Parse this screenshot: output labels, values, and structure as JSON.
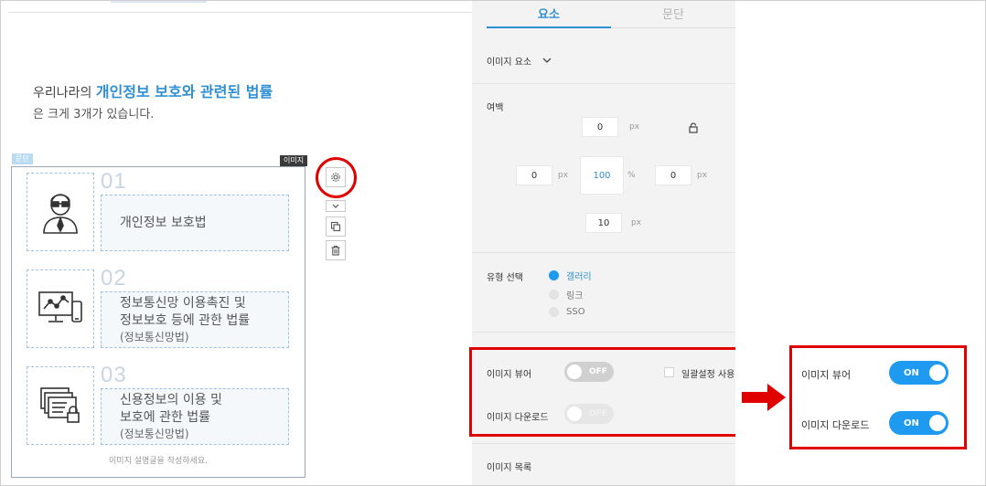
{
  "intro": {
    "prefix": "우리나라의",
    "highlight": "개인정보 보호와 관련된 법률",
    "line2": "은 크게 3개가 있습니다."
  },
  "tags": {
    "paragraph": "문단",
    "image": "이미지"
  },
  "laws": [
    {
      "number": "01",
      "title_line1": "개인정보 보호법",
      "title_line2": "",
      "sub": "",
      "icon": "person-with-glasses-icon"
    },
    {
      "number": "02",
      "title_line1": "정보통신망 이용촉진 및",
      "title_line2": "정보보호 등에 관한 법률",
      "sub": "(정보통신망법)",
      "icon": "computer-network-chart-icon"
    },
    {
      "number": "03",
      "title_line1": "신용정보의 이용 및",
      "title_line2": "보호에 관한 법률",
      "sub": "(정보통신망법)",
      "icon": "documents-lock-icon"
    }
  ],
  "caption": "이미지 설명글을 작성하세요.",
  "toolbar": {
    "settings_icon": "gear-icon",
    "collapse_icon": "chevron-down-icon",
    "copy_icon": "copy-icon",
    "delete_icon": "trash-icon"
  },
  "panel": {
    "tabs": [
      {
        "label": "요소",
        "active": true
      },
      {
        "label": "문단",
        "active": false
      }
    ],
    "element_select": "이미지 요소",
    "margin": {
      "label": "여백",
      "top": "0",
      "left": "0",
      "center": "100",
      "right": "0",
      "bottom": "10",
      "unit_px": "px",
      "unit_pct": "%"
    },
    "type_select": {
      "label": "유형 선택",
      "options": [
        {
          "label": "갤러리",
          "selected": true
        },
        {
          "label": "링크",
          "selected": false
        },
        {
          "label": "SSO",
          "selected": false
        }
      ]
    },
    "image_viewer": {
      "label": "이미지 뷰어",
      "state": "OFF"
    },
    "bulk_setting": {
      "label": "일괄설정 사용",
      "checked": false
    },
    "image_download": {
      "label": "이미지 다운로드",
      "state": "OFF"
    },
    "image_list_label": "이미지 목록"
  },
  "result": {
    "image_viewer": {
      "label": "이미지 뷰어",
      "state": "ON"
    },
    "image_download": {
      "label": "이미지 다운로드",
      "state": "ON"
    }
  },
  "colors": {
    "accent": "#1e9af0",
    "highlight_text": "#2e8fd3",
    "annotation_red": "#e00000"
  }
}
